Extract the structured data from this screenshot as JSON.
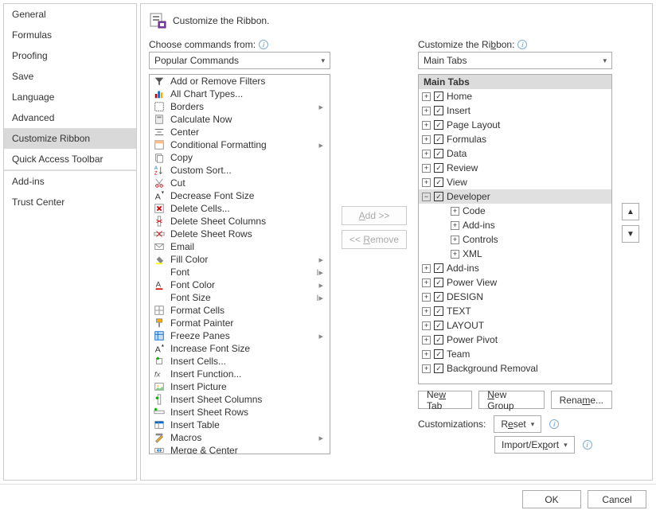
{
  "sidebar": {
    "items": [
      "General",
      "Formulas",
      "Proofing",
      "Save",
      "Language",
      "Advanced",
      "Customize Ribbon",
      "Quick Access Toolbar",
      "Add-ins",
      "Trust Center"
    ],
    "selected": 6
  },
  "header": {
    "title": "Customize the Ribbon."
  },
  "left": {
    "label": "Choose commands from:",
    "dropdown": "Popular Commands",
    "commands": [
      {
        "label": "Add or Remove Filters",
        "icon": "filter"
      },
      {
        "label": "All Chart Types...",
        "icon": "chart"
      },
      {
        "label": "Borders",
        "icon": "borders",
        "sub": true
      },
      {
        "label": "Calculate Now",
        "icon": "calc"
      },
      {
        "label": "Center",
        "icon": "center"
      },
      {
        "label": "Conditional Formatting",
        "icon": "cond",
        "sub": true
      },
      {
        "label": "Copy",
        "icon": "copy"
      },
      {
        "label": "Custom Sort...",
        "icon": "sort"
      },
      {
        "label": "Cut",
        "icon": "cut"
      },
      {
        "label": "Decrease Font Size",
        "icon": "fontdec"
      },
      {
        "label": "Delete Cells...",
        "icon": "delcells"
      },
      {
        "label": "Delete Sheet Columns",
        "icon": "delcols"
      },
      {
        "label": "Delete Sheet Rows",
        "icon": "delrows"
      },
      {
        "label": "Email",
        "icon": "email"
      },
      {
        "label": "Fill Color",
        "icon": "fillcolor",
        "sub": true
      },
      {
        "label": "Font",
        "icon": "font",
        "sub": "combo"
      },
      {
        "label": "Font Color",
        "icon": "fontcolor",
        "sub": true
      },
      {
        "label": "Font Size",
        "icon": "fontsize",
        "sub": "combo"
      },
      {
        "label": "Format Cells",
        "icon": "fmtcells"
      },
      {
        "label": "Format Painter",
        "icon": "fmtpaint"
      },
      {
        "label": "Freeze Panes",
        "icon": "freeze",
        "sub": true
      },
      {
        "label": "Increase Font Size",
        "icon": "fontinc"
      },
      {
        "label": "Insert Cells...",
        "icon": "inscells"
      },
      {
        "label": "Insert Function...",
        "icon": "insfx"
      },
      {
        "label": "Insert Picture",
        "icon": "inspic"
      },
      {
        "label": "Insert Sheet Columns",
        "icon": "inscols"
      },
      {
        "label": "Insert Sheet Rows",
        "icon": "insrows"
      },
      {
        "label": "Insert Table",
        "icon": "instable"
      },
      {
        "label": "Macros",
        "icon": "macros",
        "sub": true
      },
      {
        "label": "Merge & Center",
        "icon": "merge"
      }
    ]
  },
  "mid": {
    "add": "Add >>",
    "remove": "<< Remove"
  },
  "right": {
    "label": "Customize the Ribbon:",
    "dropdown": "Main Tabs",
    "header": "Main Tabs",
    "tabs": [
      {
        "label": "Home",
        "checked": true,
        "expanded": false
      },
      {
        "label": "Insert",
        "checked": true,
        "expanded": false
      },
      {
        "label": "Page Layout",
        "checked": true,
        "expanded": false
      },
      {
        "label": "Formulas",
        "checked": true,
        "expanded": false
      },
      {
        "label": "Data",
        "checked": true,
        "expanded": false
      },
      {
        "label": "Review",
        "checked": true,
        "expanded": false
      },
      {
        "label": "View",
        "checked": true,
        "expanded": false
      },
      {
        "label": "Developer",
        "checked": true,
        "expanded": true,
        "selected": true,
        "children": [
          "Code",
          "Add-ins",
          "Controls",
          "XML"
        ]
      },
      {
        "label": "Add-ins",
        "checked": true,
        "expanded": false
      },
      {
        "label": "Power View",
        "checked": true,
        "expanded": false
      },
      {
        "label": "DESIGN",
        "checked": true,
        "expanded": false
      },
      {
        "label": "TEXT",
        "checked": true,
        "expanded": false
      },
      {
        "label": "LAYOUT",
        "checked": true,
        "expanded": false
      },
      {
        "label": "Power Pivot",
        "checked": true,
        "expanded": false
      },
      {
        "label": "Team",
        "checked": true,
        "expanded": false
      },
      {
        "label": "Background Removal",
        "checked": true,
        "expanded": false
      }
    ],
    "buttons": {
      "newtab": "New Tab",
      "newgroup": "New Group",
      "rename": "Rename..."
    },
    "cust_label": "Customizations:",
    "reset": "Reset",
    "importexport": "Import/Export"
  },
  "footer": {
    "ok": "OK",
    "cancel": "Cancel"
  }
}
